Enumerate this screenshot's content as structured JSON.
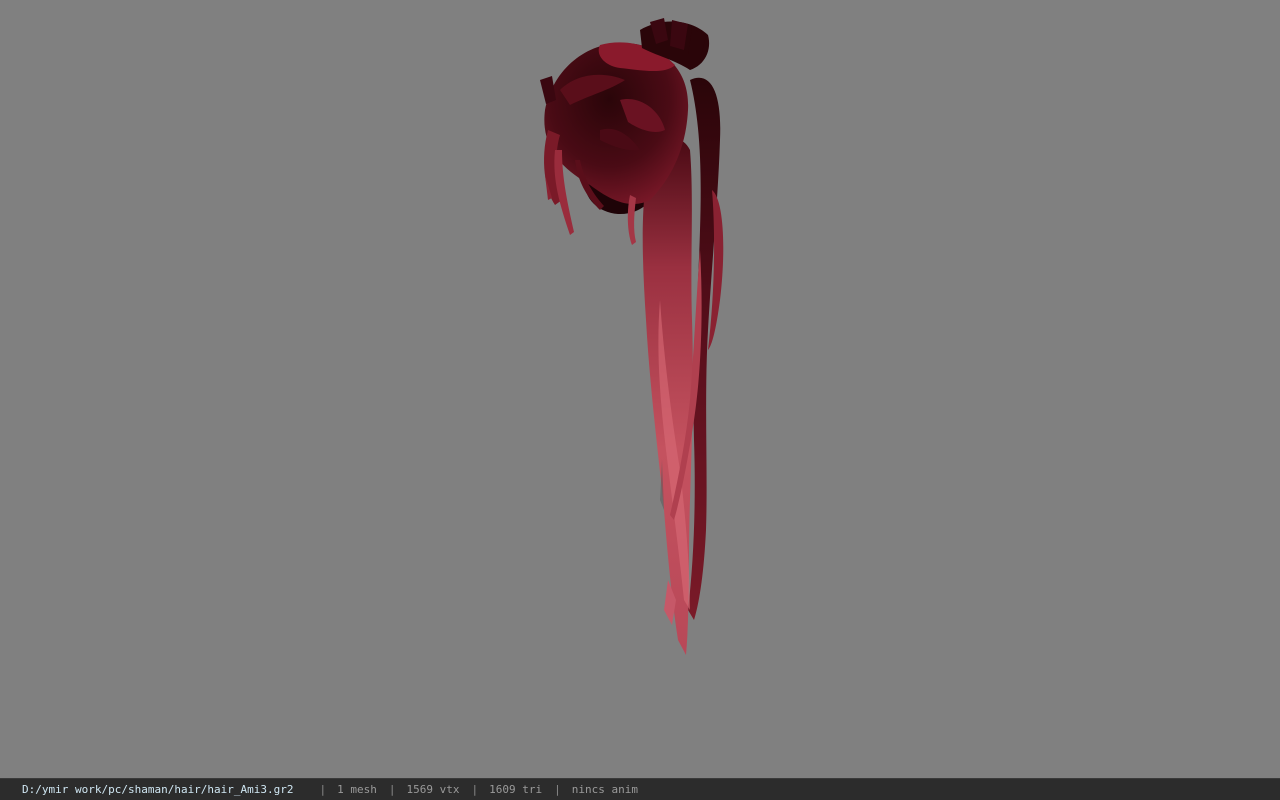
{
  "viewport": {
    "background_color": "#808080",
    "model_description_icon": "hair-mesh-model"
  },
  "statusbar": {
    "file_path": "D:/ymir work/pc/shaman/hair/hair_Ami3.gr2",
    "separator": "|",
    "mesh_count": "1 mesh",
    "vertex_count": "1569 vtx",
    "triangle_count": "1609 tri",
    "anim_status": "nincs anim"
  },
  "colors": {
    "hair_dark": "#2a0509",
    "hair_mid": "#6b1322",
    "hair_light": "#c2525f",
    "statusbar_bg": "#2c2c2c"
  }
}
